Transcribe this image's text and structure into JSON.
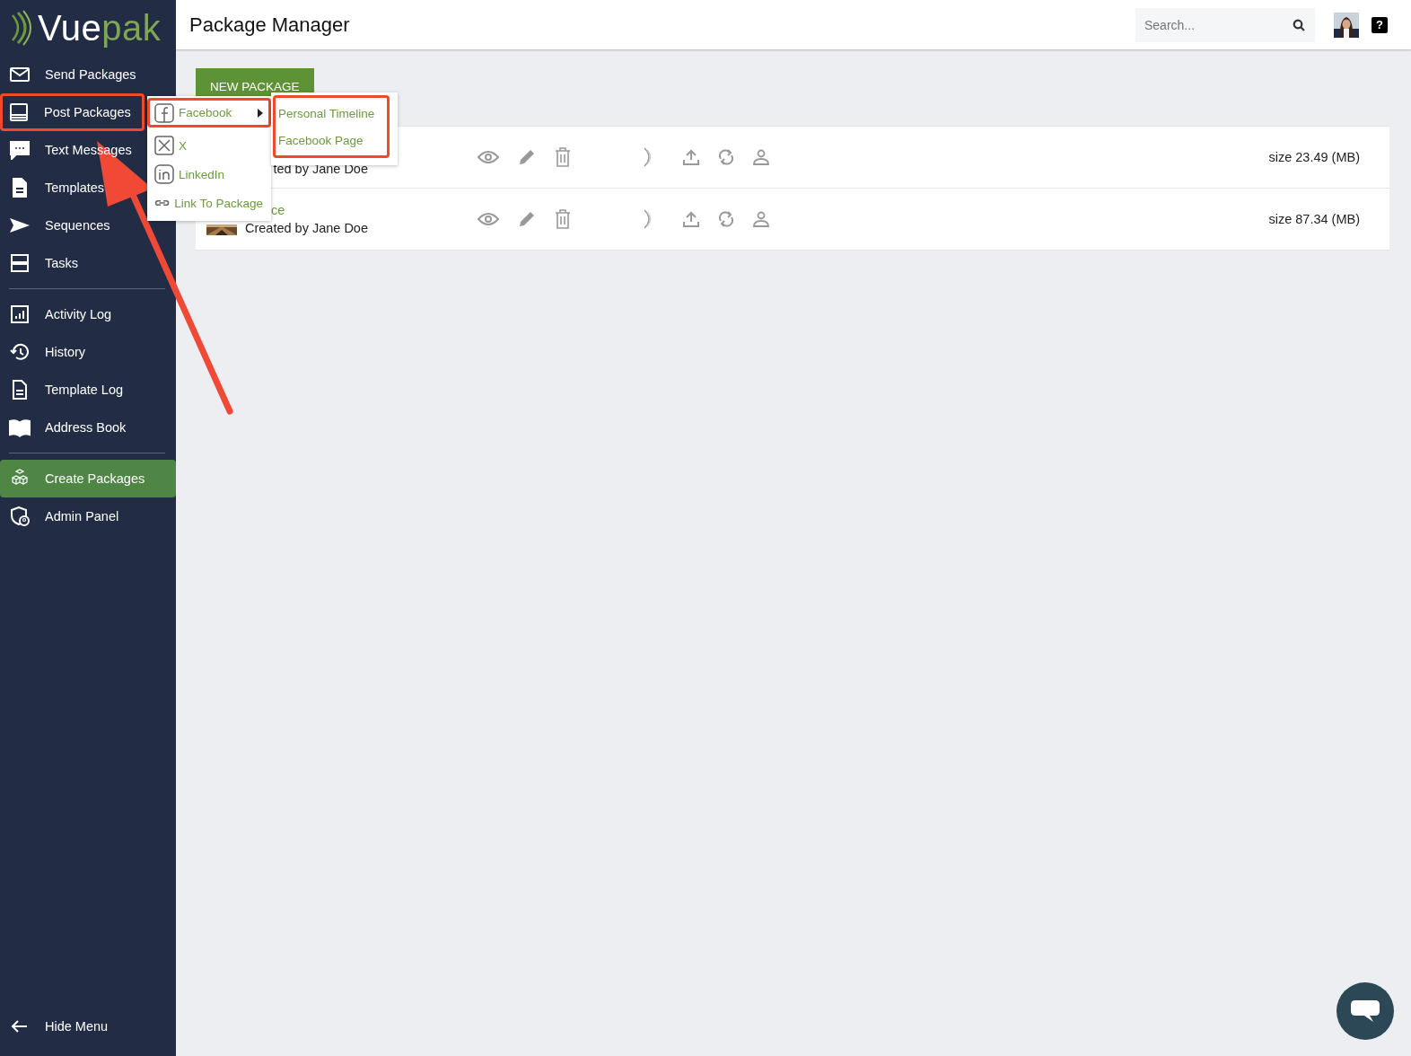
{
  "logo": {
    "primary": "Vue",
    "accent": "pak"
  },
  "sidebar": {
    "groups": [
      [
        {
          "label": "Send Packages",
          "selected": false
        },
        {
          "label": "Post Packages",
          "selected": false,
          "highlighted": true
        },
        {
          "label": "Text Messages",
          "selected": false
        },
        {
          "label": "Templates",
          "selected": false
        },
        {
          "label": "Sequences",
          "selected": false
        },
        {
          "label": "Tasks",
          "selected": false
        }
      ],
      [
        {
          "label": "Activity Log",
          "selected": false
        },
        {
          "label": "History",
          "selected": false
        },
        {
          "label": "Template Log",
          "selected": false
        },
        {
          "label": "Address Book",
          "selected": false
        }
      ],
      [
        {
          "label": "Create Packages",
          "selected": true
        },
        {
          "label": "Admin Panel",
          "selected": false
        }
      ]
    ],
    "hide_menu": "Hide Menu"
  },
  "header": {
    "title": "Package Manager",
    "search": {
      "placeholder": "Search..."
    },
    "help": "?"
  },
  "new_package_button": "NEW PACKAGE",
  "packages": [
    {
      "creator": "ted by Jane Doe",
      "size": "size 23.49 (MB)"
    },
    {
      "title": "ce",
      "creator": "Created by Jane Doe",
      "thumbnail": true,
      "size": "size 87.34 (MB)"
    }
  ],
  "share_menu": [
    {
      "label": "Facebook",
      "kind": "facebook",
      "expanded": true,
      "highlighted": true
    },
    {
      "label": "X",
      "kind": "x",
      "expanded": false
    },
    {
      "label": "LinkedIn",
      "kind": "linkedin",
      "expanded": false
    },
    {
      "label": "Link To Package",
      "kind": "link",
      "expanded": false
    }
  ],
  "facebook_submenu": {
    "highlighted": true,
    "items": [
      "Personal Timeline",
      "Facebook Page"
    ]
  }
}
